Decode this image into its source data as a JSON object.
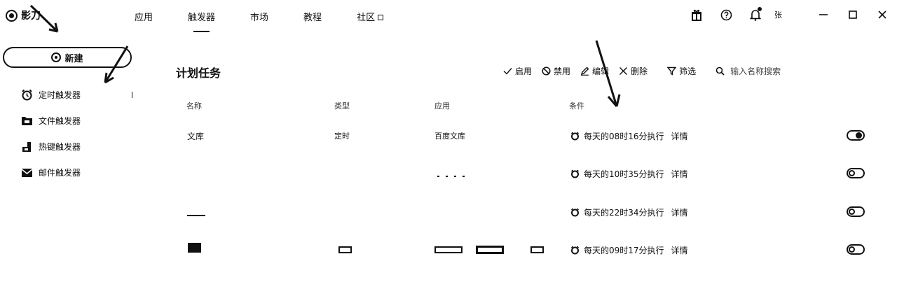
{
  "app": {
    "name": "影刀"
  },
  "nav": {
    "tabs": [
      {
        "label": "应用",
        "active": false
      },
      {
        "label": "触发器",
        "active": true
      },
      {
        "label": "市场",
        "active": false
      },
      {
        "label": "教程",
        "active": false
      },
      {
        "label": "社区",
        "active": false,
        "external": true
      }
    ]
  },
  "header": {
    "user_initial": "张"
  },
  "sidebar": {
    "new_button": "新建",
    "items": [
      {
        "label": "定时触发器",
        "icon": "alarm-clock-icon"
      },
      {
        "label": "文件触发器",
        "icon": "folder-icon"
      },
      {
        "label": "热键触发器",
        "icon": "hotkey-icon"
      },
      {
        "label": "邮件触发器",
        "icon": "mail-icon"
      }
    ]
  },
  "main": {
    "title": "计划任务",
    "actions": {
      "enable": "启用",
      "disable": "禁用",
      "edit": "编辑",
      "delete": "删除",
      "filter": "筛选",
      "search_placeholder": "输入名称搜索"
    },
    "columns": {
      "name": "名称",
      "type": "类型",
      "app": "应用",
      "condition": "条件"
    },
    "rows": [
      {
        "name": "文库",
        "type": "定时",
        "app": "百度文库",
        "condition": "每天的08时16分执行",
        "detail": "详情",
        "enabled": true
      },
      {
        "name": "",
        "type": "",
        "app": "",
        "condition": "每天的10时35分执行",
        "detail": "详情",
        "enabled": false
      },
      {
        "name": "",
        "type": "",
        "app": "",
        "condition": "每天的22时34分执行",
        "detail": "详情",
        "enabled": false
      },
      {
        "name": "",
        "type": "",
        "app": "",
        "condition": "每天的09时17分执行",
        "detail": "详情",
        "enabled": false
      }
    ]
  },
  "colors": {
    "ink": "#111111",
    "background": "#ffffff"
  }
}
